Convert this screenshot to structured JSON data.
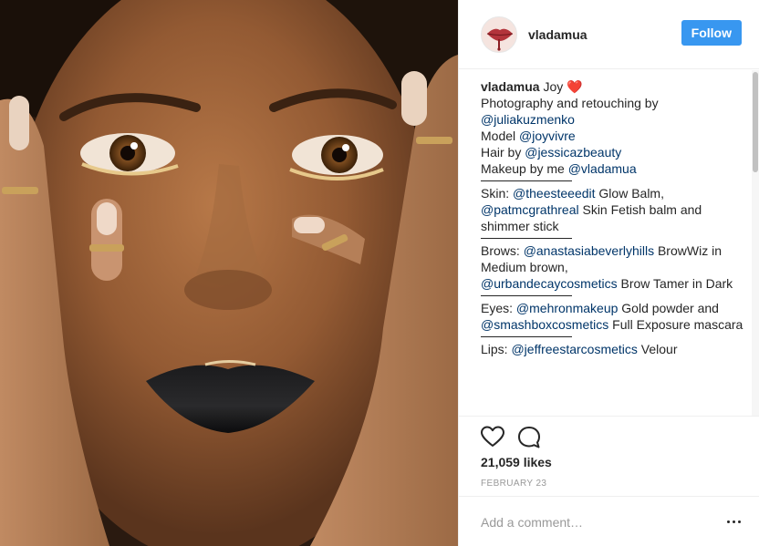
{
  "post": {
    "username": "vladamua",
    "follow_label": "Follow"
  },
  "caption": {
    "username": "vladamua",
    "title": "Joy",
    "title_emoji": "❤️",
    "lines": [
      {
        "text": "Photography and retouching by",
        "mention": ""
      },
      {
        "text": "",
        "mention": "@juliakuzmenko"
      },
      {
        "text": "Model ",
        "mention": "@joyvivre"
      },
      {
        "text": "Hair by ",
        "mention": "@jessicazbeauty"
      },
      {
        "text": "Makeup by me ",
        "mention": "@vladamua"
      }
    ],
    "skin": {
      "prefix": "Skin: ",
      "mention1": "@theesteeedit",
      "text1": " Glow Balm,",
      "mention2": "@patmcgrathreal",
      "text2": " Skin Fetish balm and shimmer stick"
    },
    "brows": {
      "prefix": "Brows: ",
      "mention1": "@anastasiabeverlyhills",
      "text1": " BrowWiz in Medium brown,",
      "mention2": "@urbandecaycosmetics",
      "text2": " Brow Tamer in Dark"
    },
    "eyes": {
      "prefix": "Eyes: ",
      "mention1": "@mehronmakeup",
      "text1": " Gold powder and",
      "mention2": "@smashboxcosmetics",
      "text2": " Full Exposure mascara"
    },
    "lips": {
      "prefix": "Lips: ",
      "mention1": "@jeffreestarcosmetics",
      "text1": " Velour"
    }
  },
  "engagement": {
    "likes": "21,059 likes",
    "date": "FEBRUARY 23"
  },
  "comment": {
    "placeholder": "Add a comment…"
  },
  "icons": {
    "like": "heart-icon",
    "comment": "comment-bubble-icon",
    "more": "more-options-icon"
  },
  "colors": {
    "follow_button": "#3897f0",
    "link": "#003569",
    "heart": "#e0245e"
  }
}
